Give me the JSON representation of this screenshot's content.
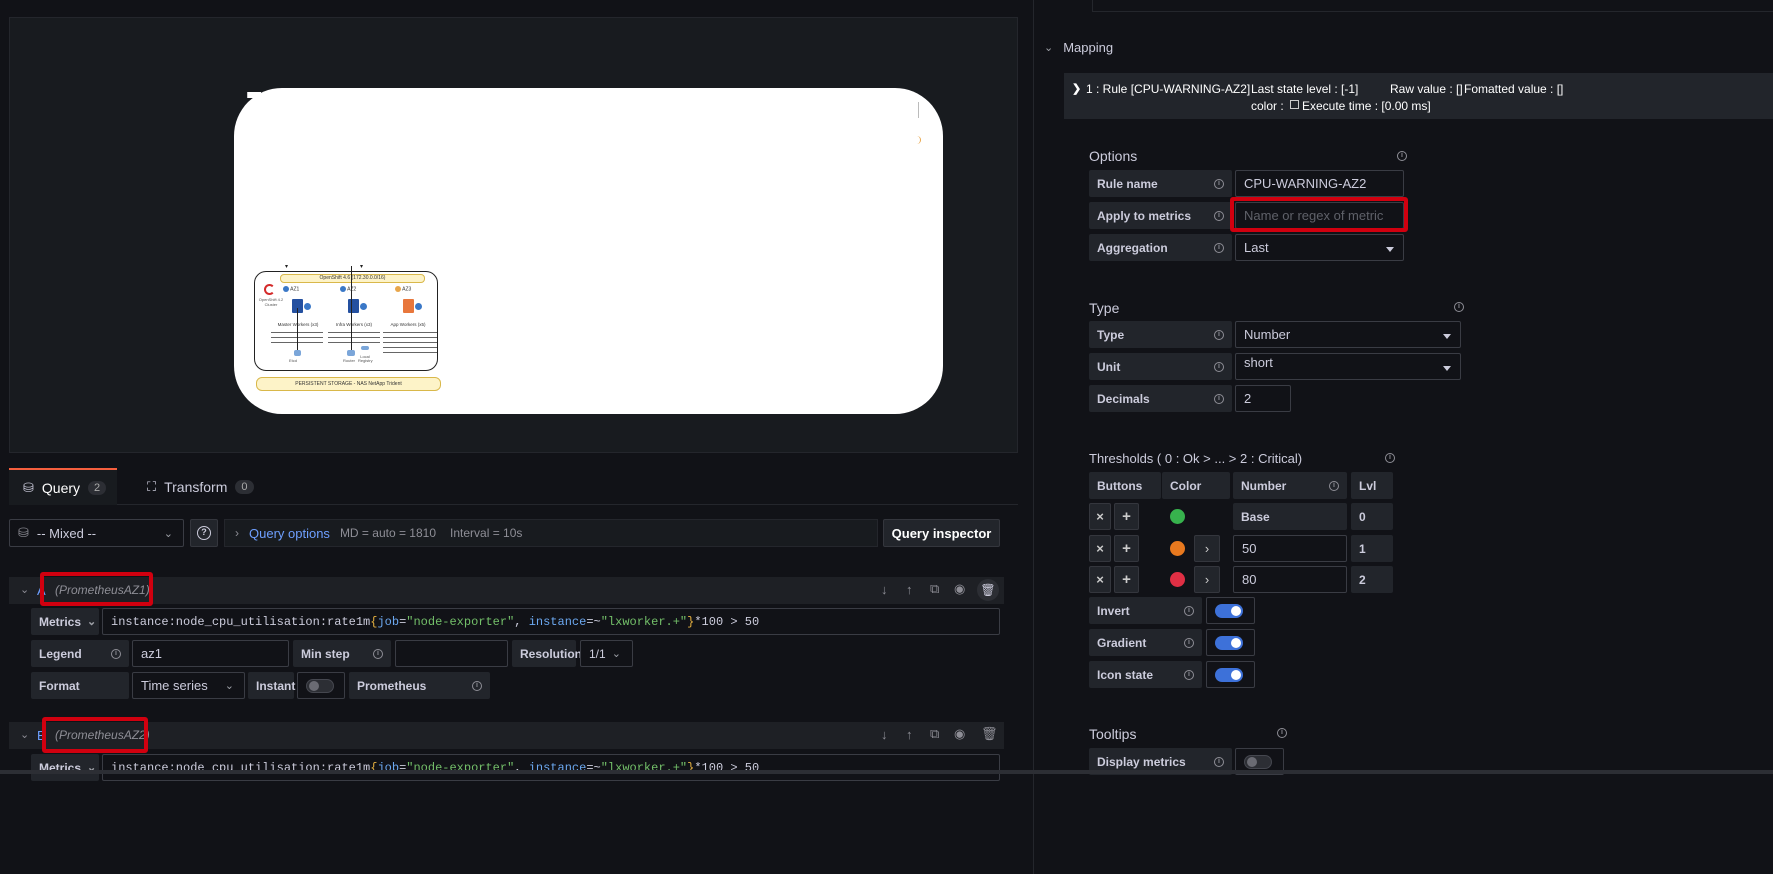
{
  "query_tabs": {
    "query_label": "Query",
    "query_count": "2",
    "transform_label": "Transform",
    "transform_count": "0"
  },
  "datasource": {
    "name": "-- Mixed --"
  },
  "query_options": {
    "label": "Query options",
    "md": "MD = auto = 1810",
    "interval": "Interval = 10s",
    "inspector": "Query inspector"
  },
  "queries": [
    {
      "datasource": "(PrometheusAZ1)",
      "metrics_label": "Metrics",
      "expr_parts": [
        {
          "t": "instance:node_cpu_utilisation:rate1m",
          "c": "#ccccdc"
        },
        {
          "t": "{",
          "c": "#e5b040"
        },
        {
          "t": "job",
          "c": "#6ca8f0"
        },
        {
          "t": "=",
          "c": "#ccccdc"
        },
        {
          "t": "\"node-exporter\"",
          "c": "#73bf69"
        },
        {
          "t": ", ",
          "c": "#ccccdc"
        },
        {
          "t": "instance",
          "c": "#6ca8f0"
        },
        {
          "t": "=~",
          "c": "#ccccdc"
        },
        {
          "t": "\"lxworker.+\"",
          "c": "#73bf69"
        },
        {
          "t": "}",
          "c": "#e5b040"
        },
        {
          "t": "*100 > 50",
          "c": "#ccccdc"
        }
      ],
      "legend_label": "Legend",
      "legend_value": "az1",
      "minstep_label": "Min step",
      "resolution_label": "Resolution",
      "resolution_value": "1/1",
      "format_label": "Format",
      "format_value": "Time series",
      "instant_label": "Instant",
      "prometheus_label": "Prometheus"
    },
    {
      "datasource": "(PrometheusAZ2)",
      "metrics_label": "Metrics",
      "expr_parts": [
        {
          "t": "instance:node_cpu_utilisation:rate1m",
          "c": "#ccccdc"
        },
        {
          "t": "{",
          "c": "#e5b040"
        },
        {
          "t": "job",
          "c": "#6ca8f0"
        },
        {
          "t": "=",
          "c": "#ccccdc"
        },
        {
          "t": "\"node-exporter\"",
          "c": "#73bf69"
        },
        {
          "t": ", ",
          "c": "#ccccdc"
        },
        {
          "t": "instance",
          "c": "#6ca8f0"
        },
        {
          "t": "=~",
          "c": "#ccccdc"
        },
        {
          "t": "\"lxworker.+\"",
          "c": "#73bf69"
        },
        {
          "t": "}",
          "c": "#e5b040"
        },
        {
          "t": "*100 > 50",
          "c": "#ccccdc"
        }
      ]
    }
  ],
  "diagram": {
    "cluster_title": "OpenShift 4.6 (172.30.0.0/16)",
    "logo_caption": "OpenShift 4.2 Cluster",
    "az_labels": [
      "AZ1",
      "AZ2",
      "AZ3"
    ],
    "group_labels": [
      "Master Workers (x3)",
      "Infra Workers (x3)",
      "App Workers (x5)"
    ],
    "storage": "PERSISTENT STORAGE - NAS NetApp Trident",
    "small_labels": [
      "Etcd",
      "Router",
      "Local Registry"
    ]
  },
  "mapping": {
    "section_title": "Mapping",
    "rule_header": "1 : Rule [CPU-WARNING-AZ2]",
    "last_state": "Last state level : [-1]",
    "raw_value": "Raw value : []",
    "formatted_value": "Fomatted value : []",
    "color_label": "color :",
    "execute_time": "Execute time : [0.00 ms]"
  },
  "options": {
    "title": "Options",
    "rule_name_label": "Rule name",
    "rule_name_value": "CPU-WARNING-AZ2",
    "apply_label": "Apply to metrics",
    "apply_placeholder": "Name or regex of metric",
    "aggregation_label": "Aggregation",
    "aggregation_value": "Last"
  },
  "type_section": {
    "title": "Type",
    "type_label": "Type",
    "type_value": "Number",
    "unit_label": "Unit",
    "unit_value": "short",
    "decimals_label": "Decimals",
    "decimals_value": "2"
  },
  "thresholds": {
    "title": "Thresholds ( 0 : Ok > ... > 2 : Critical)",
    "col_buttons": "Buttons",
    "col_color": "Color",
    "col_number": "Number",
    "col_lvl": "Lvl",
    "rows": [
      {
        "color": "#37b24d",
        "number": "Base",
        "lvl": "0"
      },
      {
        "color": "#e8791f",
        "number": "50",
        "lvl": "1"
      },
      {
        "color": "#e02f44",
        "number": "80",
        "lvl": "2"
      }
    ],
    "invert_label": "Invert",
    "gradient_label": "Gradient",
    "icon_state_label": "Icon state"
  },
  "tooltips": {
    "title": "Tooltips",
    "display_metrics_label": "Display metrics"
  }
}
